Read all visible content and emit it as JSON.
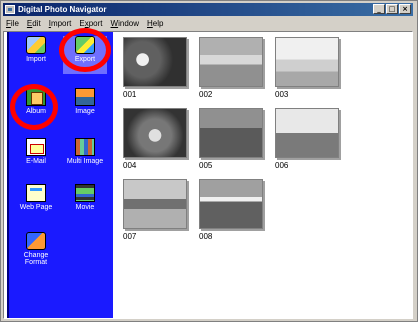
{
  "window": {
    "title": "Digital Photo Navigator",
    "controls": [
      "_",
      "□",
      "×"
    ]
  },
  "menubar": {
    "items": [
      {
        "label": "File",
        "accel": "F",
        "rest": "ile"
      },
      {
        "label": "Edit",
        "accel": "E",
        "rest": "dit"
      },
      {
        "label": "Import",
        "accel": "I",
        "rest": "mport"
      },
      {
        "label": "Export",
        "accel": "x",
        "pre": "E",
        "rest": "port"
      },
      {
        "label": "Window",
        "accel": "W",
        "rest": "indow"
      },
      {
        "label": "Help",
        "accel": "H",
        "rest": "elp"
      }
    ]
  },
  "sidebar": {
    "items": [
      {
        "label": "Import",
        "icon": "import-icon"
      },
      {
        "label": "Export",
        "icon": "export-icon"
      },
      {
        "label": "Album",
        "icon": "album-icon"
      },
      {
        "label": "Image",
        "icon": "image-icon"
      },
      {
        "label": "E-Mail",
        "icon": "email-icon"
      },
      {
        "label": "Multi Image",
        "icon": "multi-image-icon"
      },
      {
        "label": "Web Page",
        "icon": "web-page-icon"
      },
      {
        "label": "Movie",
        "icon": "movie-icon"
      },
      {
        "label": "Change Format",
        "icon": "change-format-icon"
      }
    ],
    "highlight_color": "#ff0000",
    "background": "#1a1aff"
  },
  "thumbnails": [
    "001",
    "002",
    "003",
    "004",
    "005",
    "006",
    "007",
    "008"
  ]
}
